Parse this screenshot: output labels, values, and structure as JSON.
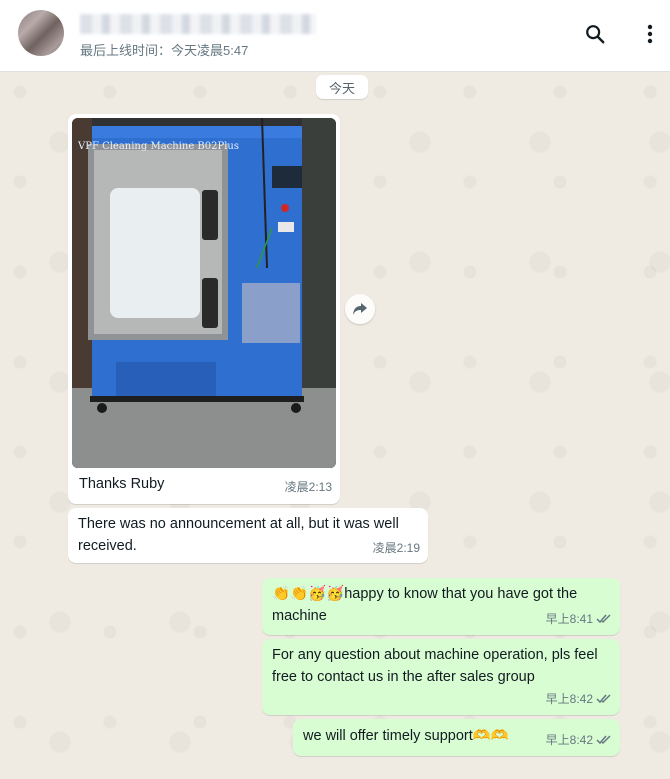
{
  "header": {
    "last_seen": "最后上线时间：今天凌晨5:47",
    "icons": [
      "search-icon",
      "more-vertical-icon"
    ]
  },
  "chat": {
    "date_chip": "今天",
    "image_message": {
      "machine_label": "VPF Cleaning Machine B02Plus",
      "caption": "Thanks Ruby",
      "time": "凌晨2:13"
    },
    "messages": [
      {
        "direction": "in",
        "text": "There was no announcement at all, but it was well received.",
        "time": "凌晨2:19"
      },
      {
        "direction": "out",
        "emoji": "👏👏🥳🥳",
        "text": "happy to know that you have got the machine",
        "time": "早上8:41",
        "status": "read"
      },
      {
        "direction": "out",
        "text": "For any question about machine operation, pls feel free to contact us in the after sales group",
        "time": "早上8:42",
        "status": "read"
      },
      {
        "direction": "out",
        "text": "we will offer timely support",
        "emoji": "🫶🫶",
        "time": "早上8:42",
        "status": "read"
      }
    ]
  },
  "colors": {
    "incoming": "#ffffff",
    "outgoing": "#d9fdd3",
    "wallpaper": "#efeae2",
    "ticks": "#667781"
  }
}
